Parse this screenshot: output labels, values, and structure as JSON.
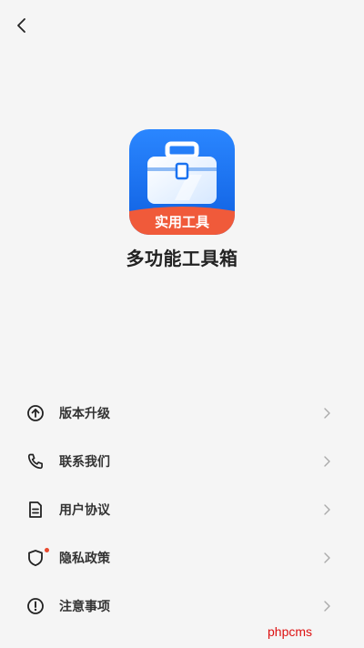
{
  "header": {
    "back_icon": "chevron-left-icon"
  },
  "app": {
    "icon_badge": "实用工具",
    "name": "多功能工具箱",
    "icon_colors": {
      "background": "#1a72f0",
      "ribbon": "#f05a3a"
    }
  },
  "menu": {
    "items": [
      {
        "label": "版本升级",
        "icon": "arrow-up-circle-icon"
      },
      {
        "label": "联系我们",
        "icon": "phone-icon"
      },
      {
        "label": "用户协议",
        "icon": "document-icon"
      },
      {
        "label": "隐私政策",
        "icon": "shield-icon",
        "badge_dot": true
      },
      {
        "label": "注意事项",
        "icon": "exclamation-circle-icon"
      }
    ]
  },
  "watermark": "phpcms",
  "colors": {
    "badge_dot": "#e94a2f",
    "watermark": "#dd1111"
  }
}
